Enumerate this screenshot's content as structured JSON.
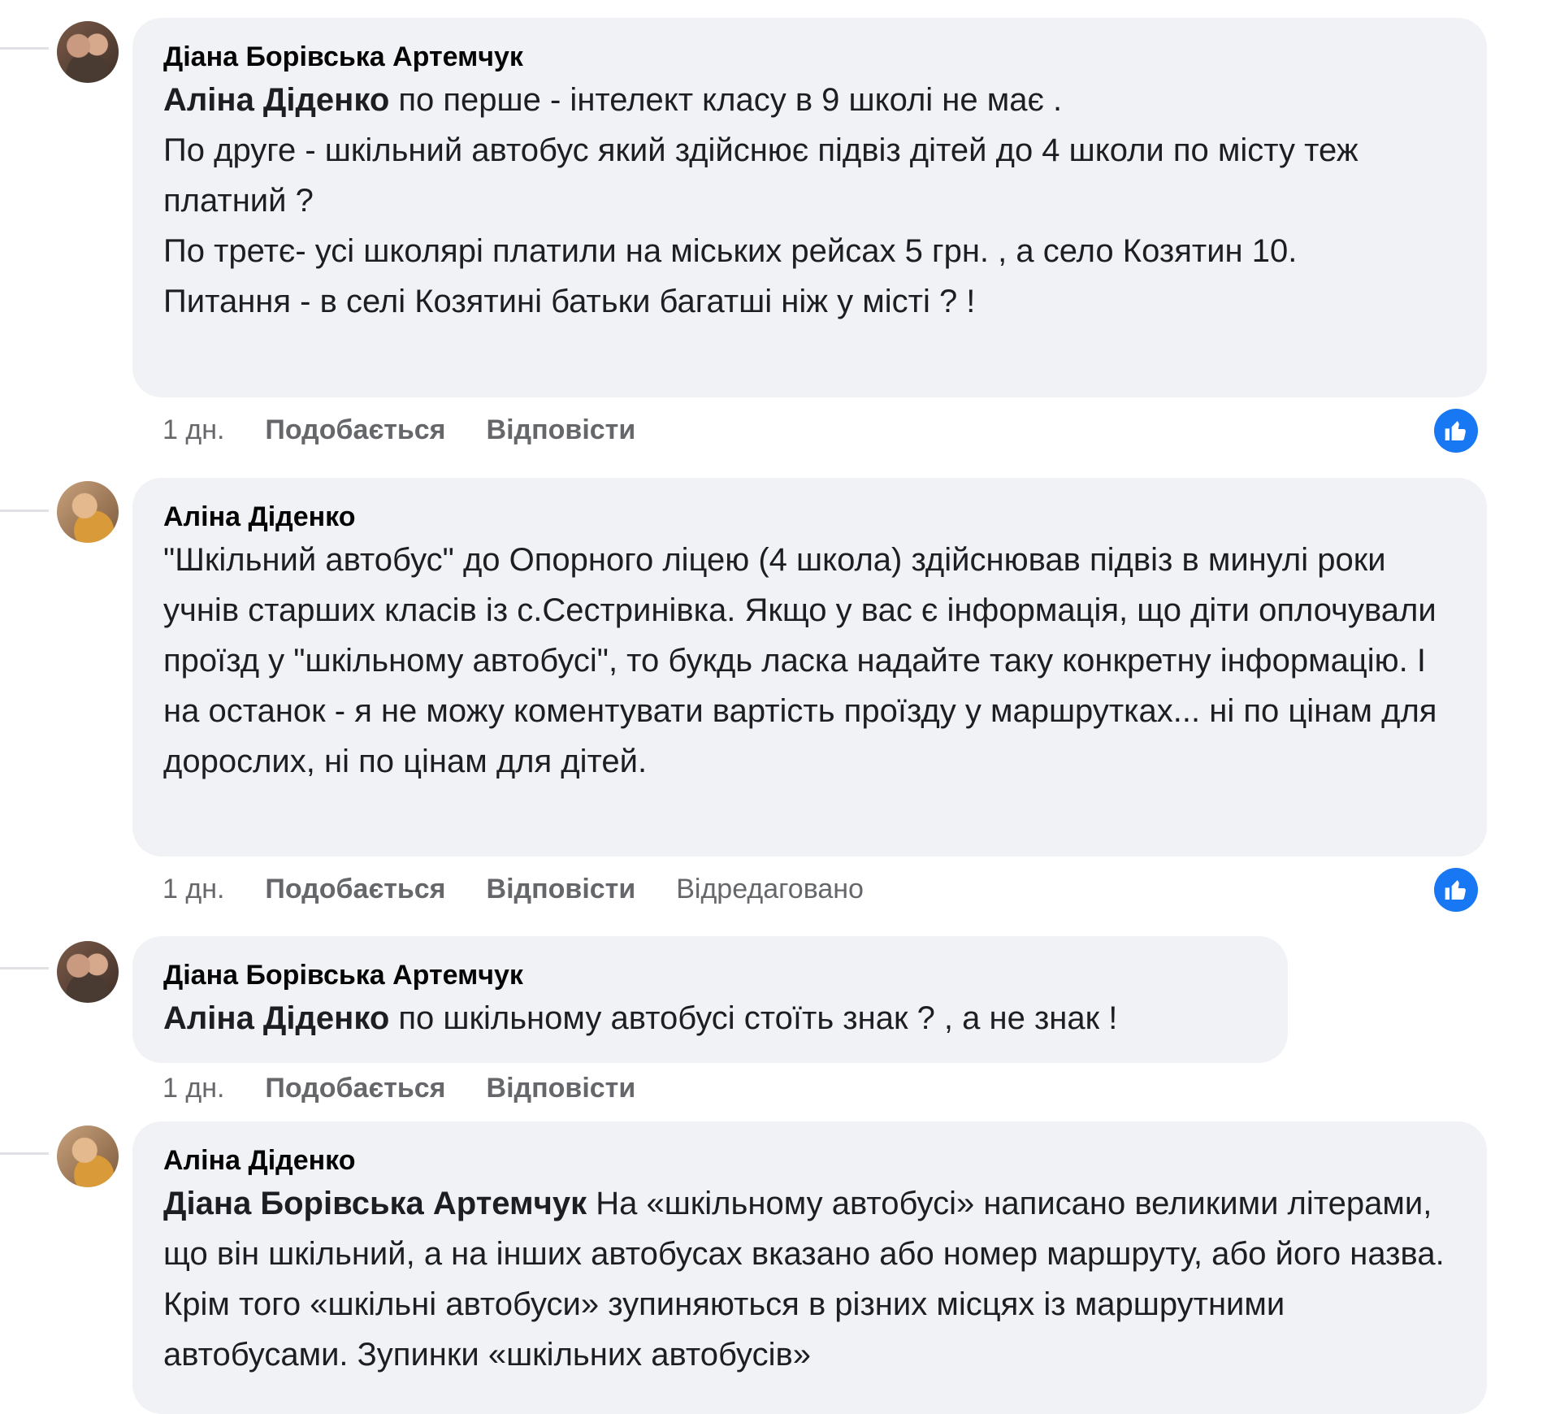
{
  "comments": [
    {
      "author": "Діана Борівська Артемчук",
      "mention": "Аліна Діденко",
      "text": " по перше - інтелект класу в 9 школі не має .\nПо друге - шкільний автобус який здійснює підвіз дітей до 4 школи по місту теж платний ?\nПо третє- усі школярі платили на міських рейсах 5 грн. , а село Козятин 10.\nПитання - в селі Козятині батьки багатші ніж у місті ? !",
      "time": "1 дн.",
      "like_label": "Подобається",
      "reply_label": "Відповісти",
      "reaction_icon": "like-icon"
    },
    {
      "author": "Аліна Діденко",
      "mention": "",
      "text": "\"Шкільний автобус\" до Опорного ліцею (4 школа) здійснював підвіз в минулі роки учнів старших класів із с.Сестринівка. Якщо у вас є інформація, що діти оплочували проїзд у \"шкільному автобусі\", то букдь ласка надайте таку конкретну інформацію. І на останок - я не можу коментувати вартість проїзду у маршрутках... ні по цінам для дорослих, ні по цінам для дітей.",
      "time": "1 дн.",
      "like_label": "Подобається",
      "reply_label": "Відповісти",
      "edited_label": "Відредаговано",
      "reaction_icon": "like-icon"
    },
    {
      "author": "Діана Борівська Артемчук",
      "mention": "Аліна Діденко",
      "text": " по шкільному автобусі стоїть знак ? , а не знак !",
      "time": "1 дн.",
      "like_label": "Подобається",
      "reply_label": "Відповісти"
    },
    {
      "author": "Аліна Діденко",
      "mention": "Діана Борівська Артемчук",
      "text": " На «шкільному автобусі» написано великими літерами, що він шкільний, а на інших автобусах вказано або номер маршруту, або його назва. Крім того «шкільні автобуси» зупиняються в різних місцях із маршрутними автобусами. Зупинки «шкільних автобусів»"
    }
  ]
}
